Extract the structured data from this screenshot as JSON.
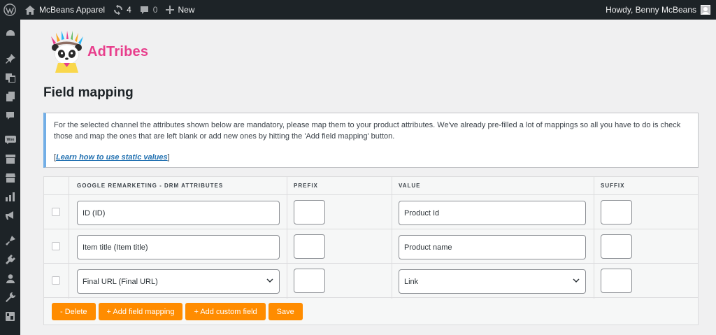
{
  "admin_bar": {
    "site_name": "McBeans Apparel",
    "updates_count": "4",
    "comments_count": "0",
    "new_label": "New",
    "greeting": "Howdy, Benny McBeans"
  },
  "sidebar": {
    "icons": [
      "dashboard-icon",
      "pin-icon",
      "media-icon",
      "pages-icon",
      "comments-icon",
      "woocommerce-icon",
      "products-icon",
      "store-icon",
      "analytics-icon",
      "marketing-icon",
      "appearance-icon",
      "plugins-icon",
      "users-icon",
      "tools-icon",
      "settings-icon"
    ]
  },
  "logo": {
    "brand": "AdTribes"
  },
  "page_title": "Field mapping",
  "notice": {
    "text": "For the selected channel the attributes shown below are mandatory, please map them to your product attributes. We've already pre-filled a lot of mappings so all you have to do is check those and map the ones that are left blank or add new ones by hitting the 'Add field mapping' button.",
    "link_text": "Learn how to use static values",
    "bracket_open": "[",
    "bracket_close": "]"
  },
  "table": {
    "headers": [
      "GOOGLE REMARKETING - DRM ATTRIBUTES",
      "PREFIX",
      "VALUE",
      "SUFFIX"
    ],
    "rows": [
      {
        "attribute": "ID (ID)",
        "attribute_type": "text",
        "prefix": "",
        "value": "Product Id",
        "value_type": "text",
        "suffix": ""
      },
      {
        "attribute": "Item title (Item title)",
        "attribute_type": "text",
        "prefix": "",
        "value": "Product name",
        "value_type": "text",
        "suffix": ""
      },
      {
        "attribute": "Final URL (Final URL)",
        "attribute_type": "select",
        "prefix": "",
        "value": "Link",
        "value_type": "select",
        "suffix": ""
      }
    ]
  },
  "buttons": {
    "delete": "- Delete",
    "add_field_mapping": "+ Add field mapping",
    "add_custom_field": "+ Add custom field",
    "save": "Save"
  },
  "colors": {
    "admin_bar_bg": "#1d2327",
    "button_orange": "#ff8c00",
    "brand_pink": "#e83e8c",
    "notice_border": "#72aee6",
    "link_blue": "#2271b1"
  }
}
